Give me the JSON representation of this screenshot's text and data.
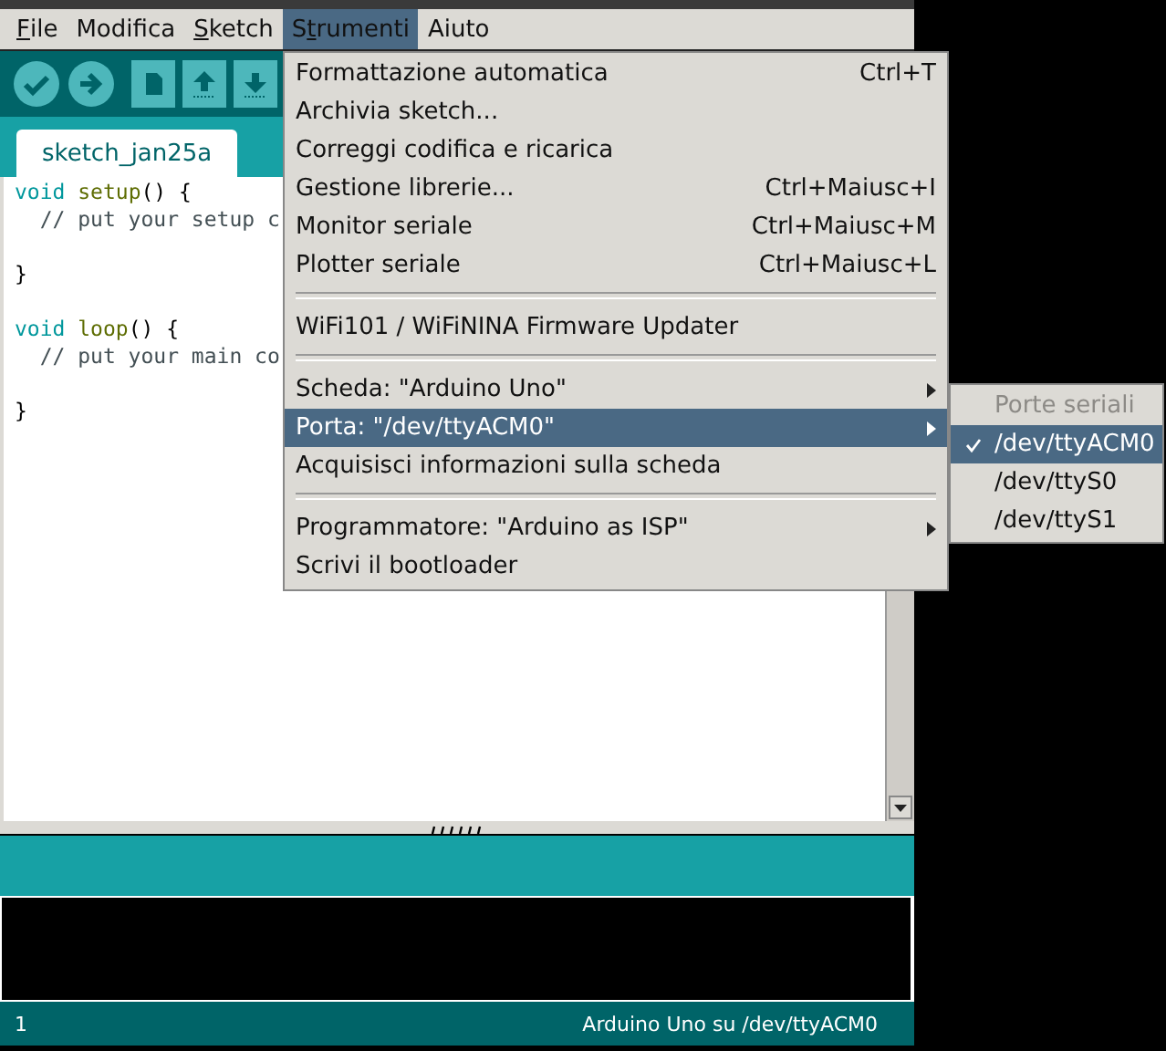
{
  "menubar": [
    {
      "key": "F",
      "after": "ile",
      "selected": false
    },
    {
      "before": "Modifica",
      "selected": false
    },
    {
      "key": "S",
      "after": "ketch",
      "selected": false
    },
    {
      "before": "S",
      "key": "t",
      "after": "rumenti",
      "selected": true
    },
    {
      "before": "Aiuto",
      "selected": false
    }
  ],
  "toolbar": [
    {
      "kind": "verify"
    },
    {
      "kind": "upload"
    },
    {
      "kind": "new"
    },
    {
      "kind": "open"
    },
    {
      "kind": "save"
    }
  ],
  "tabs": [
    {
      "label": "sketch_jan25a",
      "selected": true
    }
  ],
  "code": [
    {
      "kind": "code",
      "tokens": [
        {
          "text": "void",
          "kind": "keyword"
        },
        {
          "text": " setup",
          "kind": "function"
        },
        {
          "text": "() {",
          "kind": "plain"
        }
      ]
    },
    {
      "kind": "code",
      "tokens": [
        {
          "text": "  // put your setup c",
          "kind": "comment"
        }
      ]
    },
    {
      "kind": "blank"
    },
    {
      "kind": "code",
      "tokens": [
        {
          "text": "}",
          "kind": "plain"
        }
      ]
    },
    {
      "kind": "blank"
    },
    {
      "kind": "code",
      "tokens": [
        {
          "text": "void",
          "kind": "keyword"
        },
        {
          "text": " loop",
          "kind": "function"
        },
        {
          "text": "() {",
          "kind": "plain"
        }
      ]
    },
    {
      "kind": "code",
      "tokens": [
        {
          "text": "  // put your main co",
          "kind": "comment"
        }
      ]
    },
    {
      "kind": "blank"
    },
    {
      "kind": "code",
      "tokens": [
        {
          "text": "}",
          "kind": "plain"
        }
      ]
    }
  ],
  "menu": [
    {
      "kind": "item",
      "label": "Formattazione automatica",
      "shortcut": "Ctrl+T",
      "selected": false
    },
    {
      "kind": "item",
      "label": "Archivia sketch...",
      "selected": false
    },
    {
      "kind": "item",
      "label": "Correggi codifica e ricarica",
      "selected": false
    },
    {
      "kind": "item",
      "label": "Gestione librerie...",
      "shortcut": "Ctrl+Maiusc+I",
      "selected": false
    },
    {
      "kind": "item",
      "label": "Monitor seriale",
      "shortcut": "Ctrl+Maiusc+M",
      "selected": false
    },
    {
      "kind": "item",
      "label": "Plotter seriale",
      "shortcut": "Ctrl+Maiusc+L",
      "selected": false
    },
    {
      "kind": "separator"
    },
    {
      "kind": "item",
      "label": "WiFi101 / WiFiNINA Firmware Updater",
      "selected": false
    },
    {
      "kind": "separator"
    },
    {
      "kind": "submenu",
      "label": "Scheda: \"Arduino Uno\"",
      "selected": false
    },
    {
      "kind": "submenu",
      "label": "Porta: \"/dev/ttyACM0\"",
      "selected": true
    },
    {
      "kind": "item",
      "label": "Acquisisci informazioni sulla scheda",
      "selected": false
    },
    {
      "kind": "separator"
    },
    {
      "kind": "submenu",
      "label": "Programmatore: \"Arduino as ISP\"",
      "selected": false
    },
    {
      "kind": "item",
      "label": "Scrivi il bootloader",
      "selected": false
    }
  ],
  "submenu": [
    {
      "label": "Porte seriali",
      "disabled": true,
      "checked": false,
      "selected": false
    },
    {
      "label": "/dev/ttyACM0",
      "disabled": false,
      "checked": true,
      "selected": true
    },
    {
      "label": "/dev/ttyS0",
      "disabled": false,
      "checked": false,
      "selected": false
    },
    {
      "label": "/dev/ttyS1",
      "disabled": false,
      "checked": false,
      "selected": false
    }
  ],
  "status_bar": {
    "line": "1",
    "board": "Arduino Uno su /dev/ttyACM0"
  }
}
